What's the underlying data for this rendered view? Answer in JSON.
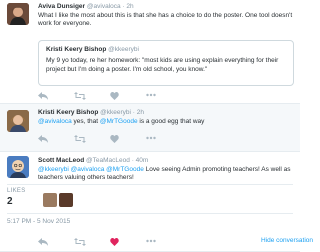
{
  "tweets": [
    {
      "name": "Aviva Dunsiger",
      "handle": "@avivaloca",
      "time": "2h",
      "text": "What I like the most about this is that she has a choice to do the poster. One tool doesn't work for everyone.",
      "quote": {
        "name": "Kristi Keery Bishop",
        "handle": "@kkeerybi",
        "text": "My 9 yo today, re her homework: \"most kids are using explain everything for their project but I'm doing a poster. I'm old school, you know.\""
      }
    },
    {
      "name": "Kristi Keery Bishop",
      "handle": "@kkeerybi",
      "time": "2h",
      "mention1": "@avivaloca",
      "text_mid": " yes, that ",
      "mention2": "@MrTGoode",
      "text_end": " is a good egg that way"
    },
    {
      "name": "Scott MacLeod",
      "handle": "@TeaMacLeod",
      "time": "40m",
      "mention1": "@kkeerybi",
      "mention2": "@avivaloca",
      "mention3": "@MrTGoode",
      "text_end": " Love seeing Admin promoting teachers! As well as teachers valuing others teachers!",
      "likes_label": "LIKES",
      "likes_count": "2",
      "timestamp": "5:17 PM - 5 Nov 2015",
      "hide_label": "Hide conversation"
    }
  ],
  "colors": {
    "link": "#1da1f2",
    "muted": "#8899a6",
    "like_active": "#e0245e"
  },
  "icons": [
    "reply-icon",
    "retweet-icon",
    "like-icon",
    "more-icon"
  ]
}
